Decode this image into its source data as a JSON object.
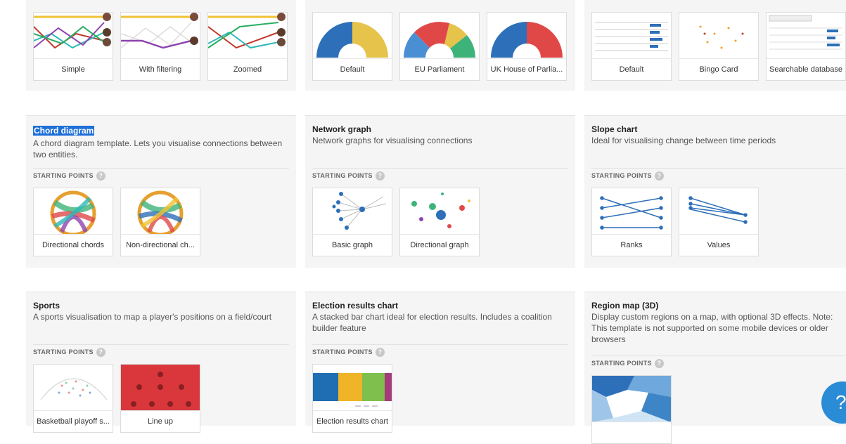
{
  "top_row": {
    "col1": [
      "Simple",
      "With filtering",
      "Zoomed"
    ],
    "col2": [
      "Default",
      "EU Parliament",
      "UK House of Parlia..."
    ],
    "col3": [
      "Default",
      "Bingo Card",
      "Searchable database"
    ]
  },
  "starting_points_label": "STARTING POINTS",
  "help_glyph": "?",
  "fab_glyph": "?",
  "cards": [
    {
      "title": "Chord diagram",
      "description": "A chord diagram template. Lets you visualise connections between two entities.",
      "thumbs": [
        "Directional chords",
        "Non-directional ch..."
      ]
    },
    {
      "title": "Network graph",
      "description": "Network graphs for visualising connections",
      "thumbs": [
        "Basic graph",
        "Directional graph"
      ]
    },
    {
      "title": "Slope chart",
      "description": "Ideal for visualising change between time periods",
      "thumbs": [
        "Ranks",
        "Values"
      ]
    },
    {
      "title": "Sports",
      "description": "A sports visualisation to map a player's positions on a field/court",
      "thumbs": [
        "Basketball playoff s...",
        "Line up"
      ]
    },
    {
      "title": "Election results chart",
      "description": "A stacked bar chart ideal for election results. Includes a coalition builder feature",
      "thumbs": [
        "Election results chart"
      ]
    },
    {
      "title": "Region map (3D)",
      "description": "Display custom regions on a map, with optional 3D effects. Note: This template is not supported on some mobile devices or older browsers",
      "thumbs": [
        ""
      ]
    }
  ],
  "colors": {
    "selection": "#1e6fd9",
    "fab": "#2a8bd6",
    "card_bg": "#f5f5f5"
  }
}
